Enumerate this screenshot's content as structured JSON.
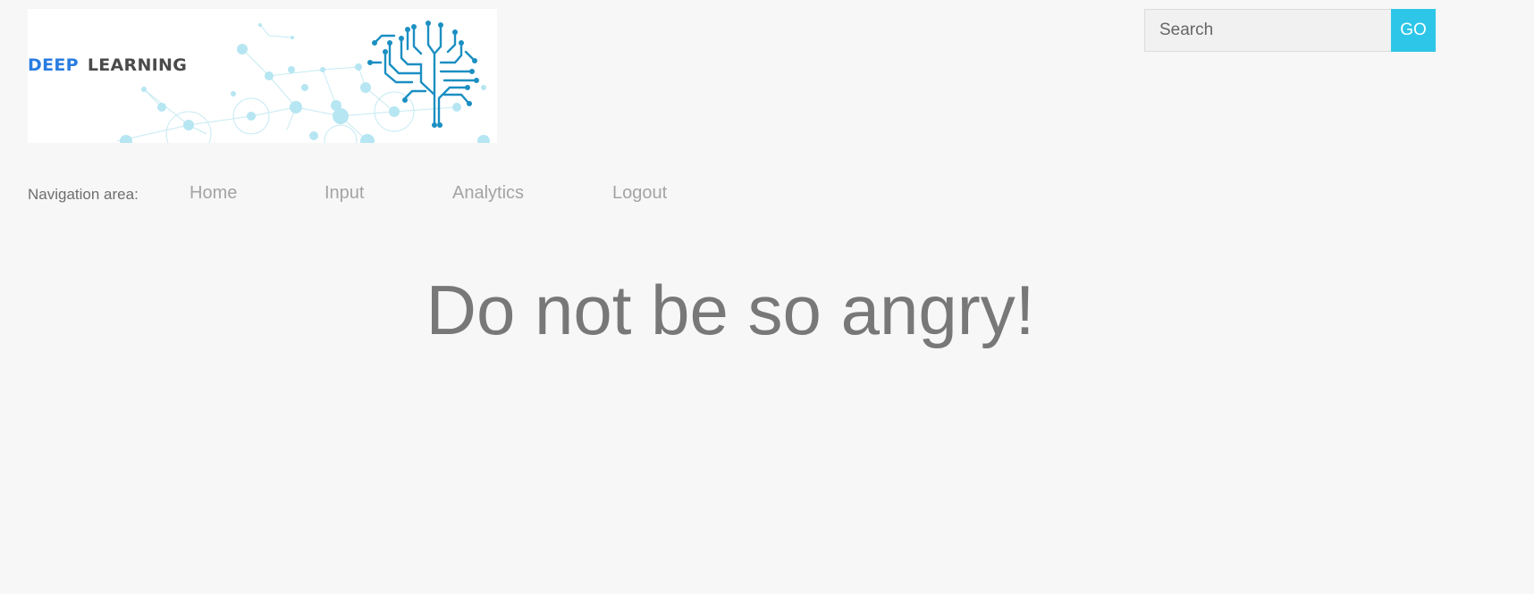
{
  "logo": {
    "word1": "DEEP",
    "word2": "LEARNING",
    "word1_color": "#2a7de1",
    "word2_color": "#4a4a4a",
    "brain_color": "#1b8fc2"
  },
  "search": {
    "placeholder": "Search",
    "value": "",
    "button_label": "GO",
    "button_color": "#2ec6e8"
  },
  "nav": {
    "label": "Navigation area:",
    "items": [
      {
        "label": "Home"
      },
      {
        "label": "Input"
      },
      {
        "label": "Analytics"
      },
      {
        "label": "Logout"
      }
    ]
  },
  "main": {
    "headline": "Do not be so angry!"
  }
}
